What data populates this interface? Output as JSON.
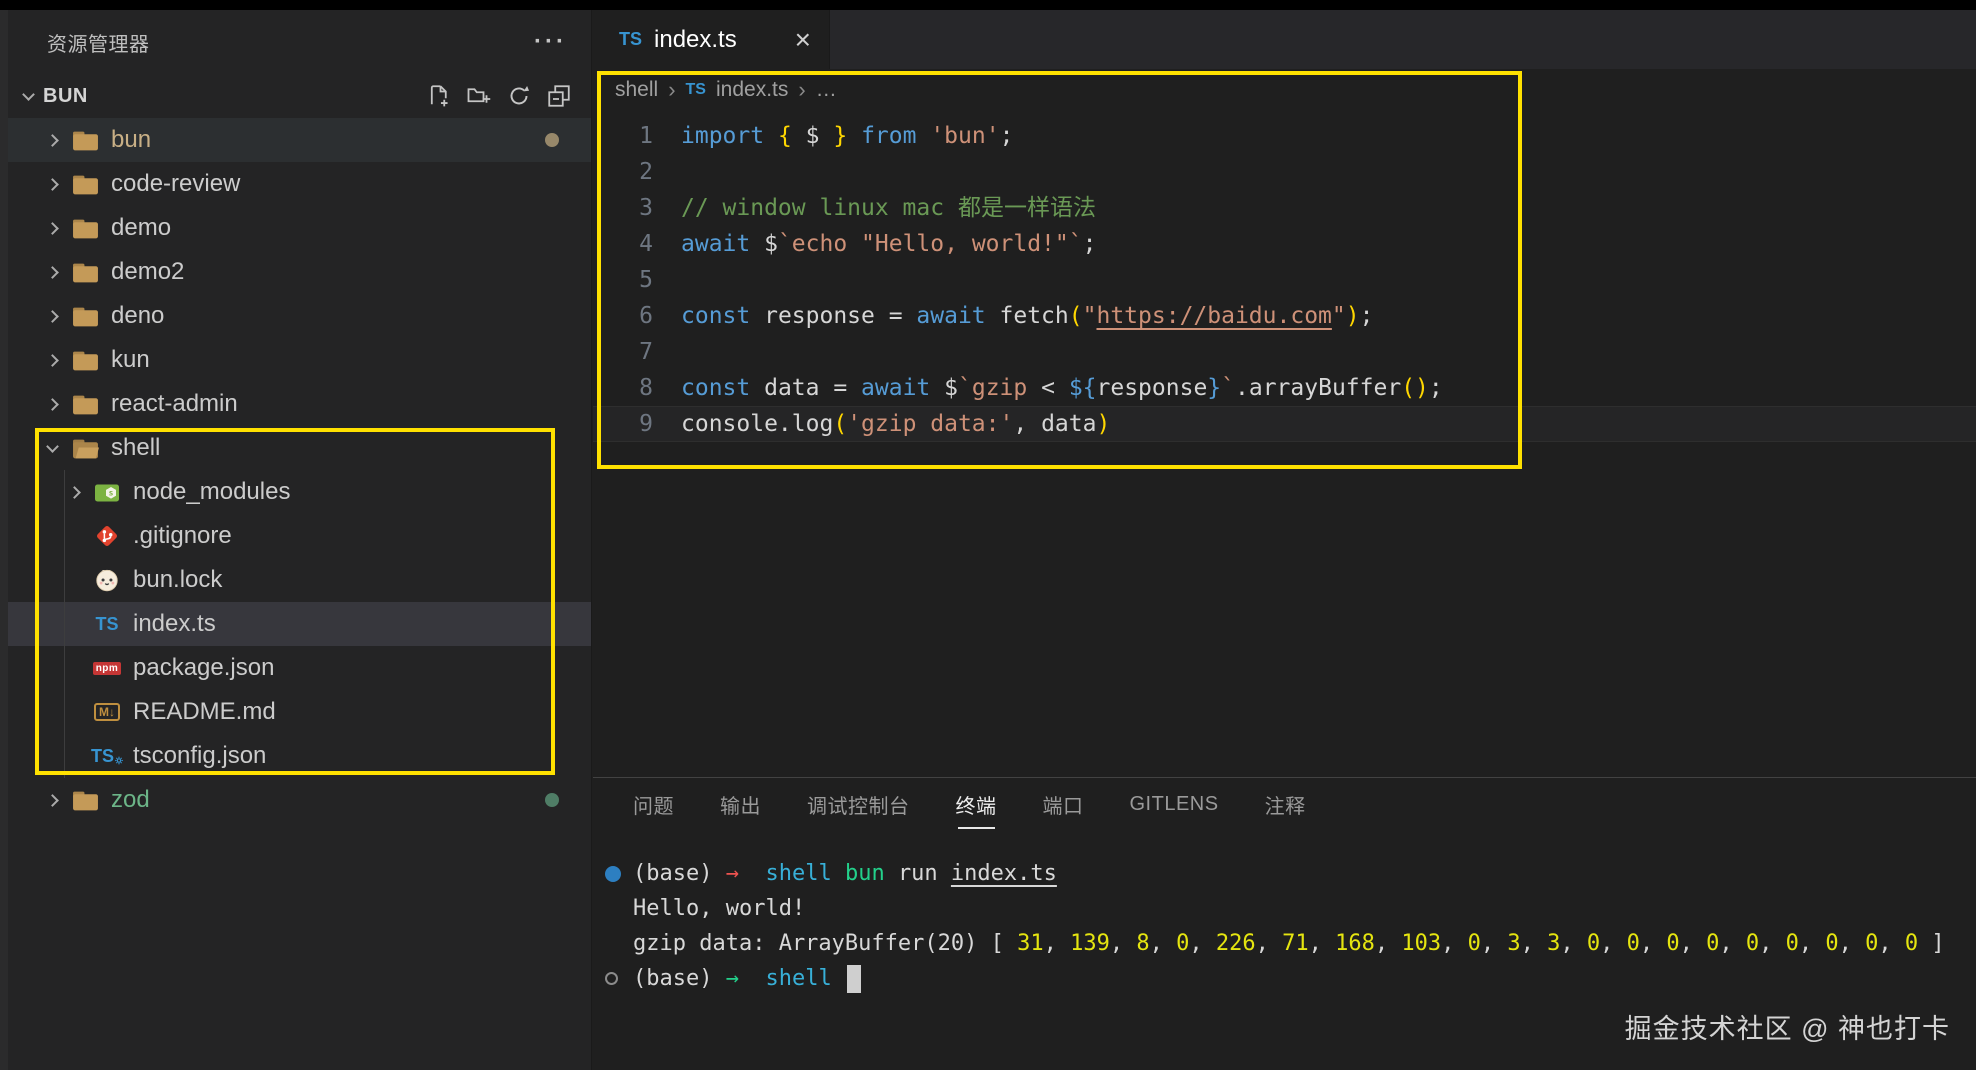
{
  "explorer": {
    "title": "资源管理器",
    "more_actions": "···",
    "section": {
      "label": "BUN"
    },
    "tree": [
      {
        "label": "bun",
        "icon": "folder",
        "chevron": "right",
        "depth": 0,
        "label_color": "#c9b086",
        "dot": "#97886a",
        "row_bg": "#2c2f31"
      },
      {
        "label": "code-review",
        "icon": "folder",
        "chevron": "right",
        "depth": 0
      },
      {
        "label": "demo",
        "icon": "folder",
        "chevron": "right",
        "depth": 0
      },
      {
        "label": "demo2",
        "icon": "folder",
        "chevron": "right",
        "depth": 0
      },
      {
        "label": "deno",
        "icon": "folder",
        "chevron": "right",
        "depth": 0
      },
      {
        "label": "kun",
        "icon": "folder",
        "chevron": "right",
        "depth": 0
      },
      {
        "label": "react-admin",
        "icon": "folder",
        "chevron": "right",
        "depth": 0
      },
      {
        "label": "shell",
        "icon": "folder-open",
        "chevron": "down",
        "depth": 0
      },
      {
        "label": "node_modules",
        "icon": "node",
        "chevron": "right",
        "depth": 1
      },
      {
        "label": ".gitignore",
        "icon": "git",
        "chevron": "none",
        "depth": 1
      },
      {
        "label": "bun.lock",
        "icon": "bun",
        "chevron": "none",
        "depth": 1
      },
      {
        "label": "index.ts",
        "icon": "ts",
        "chevron": "none",
        "depth": 1,
        "selected": true
      },
      {
        "label": "package.json",
        "icon": "npm",
        "chevron": "none",
        "depth": 1
      },
      {
        "label": "README.md",
        "icon": "md",
        "chevron": "none",
        "depth": 1
      },
      {
        "label": "tsconfig.json",
        "icon": "tsconfig",
        "chevron": "none",
        "depth": 1
      },
      {
        "label": "zod",
        "icon": "folder",
        "chevron": "right",
        "depth": 0,
        "label_color": "#6cb588",
        "dot": "#4f7d66"
      }
    ]
  },
  "editor": {
    "tab": {
      "label": "index.ts",
      "close": "×"
    },
    "breadcrumb": {
      "folder": "shell",
      "ts_badge": "TS",
      "file": "index.ts",
      "sep": "›",
      "more": "…"
    },
    "code_lines": [
      {
        "no": "1",
        "segs": [
          [
            "import ",
            "kw"
          ],
          [
            "{ ",
            "br"
          ],
          [
            "$",
            "fg"
          ],
          [
            " }",
            "br"
          ],
          [
            " ",
            "fg"
          ],
          [
            "from",
            "kw"
          ],
          [
            " ",
            "fg"
          ],
          [
            "'bun'",
            "str"
          ],
          [
            ";",
            "fg"
          ]
        ]
      },
      {
        "no": "2",
        "segs": []
      },
      {
        "no": "3",
        "segs": [
          [
            "// window linux mac 都是一样语法",
            "cm"
          ]
        ]
      },
      {
        "no": "4",
        "segs": [
          [
            "await ",
            "kw"
          ],
          [
            "$",
            "fg"
          ],
          [
            "`echo \"Hello, world!\"`",
            "str"
          ],
          [
            ";",
            "fg"
          ]
        ]
      },
      {
        "no": "5",
        "segs": []
      },
      {
        "no": "6",
        "segs": [
          [
            "const ",
            "kw"
          ],
          [
            "response ",
            "fg"
          ],
          [
            "= ",
            "fg"
          ],
          [
            "await ",
            "kw"
          ],
          [
            "fetch",
            "fg"
          ],
          [
            "(",
            "br"
          ],
          [
            "\"",
            "str"
          ],
          [
            "https://baidu.com",
            "link"
          ],
          [
            "\"",
            "str"
          ],
          [
            ")",
            "br"
          ],
          [
            ";",
            "fg"
          ]
        ]
      },
      {
        "no": "7",
        "segs": []
      },
      {
        "no": "8",
        "segs": [
          [
            "const ",
            "kw"
          ],
          [
            "data ",
            "fg"
          ],
          [
            "= ",
            "fg"
          ],
          [
            "await ",
            "kw"
          ],
          [
            "$",
            "fg"
          ],
          [
            "`",
            "str"
          ],
          [
            "gzip ",
            "str"
          ],
          [
            "< ",
            "fg"
          ],
          [
            "${",
            "kw"
          ],
          [
            "response",
            "fg"
          ],
          [
            "}",
            "kw"
          ],
          [
            "`",
            "str"
          ],
          [
            ".arrayBuffer",
            "fg"
          ],
          [
            "()",
            "br"
          ],
          [
            ";",
            "fg"
          ]
        ]
      },
      {
        "no": "9",
        "segs": [
          [
            "console.log",
            "fg"
          ],
          [
            "(",
            "br"
          ],
          [
            "'gzip data:'",
            "str"
          ],
          [
            ", ",
            "fg"
          ],
          [
            "data",
            "fg"
          ],
          [
            ")",
            "br"
          ]
        ],
        "highlight": true
      }
    ]
  },
  "panel": {
    "tabs": [
      {
        "label": "问题"
      },
      {
        "label": "输出"
      },
      {
        "label": "调试控制台"
      },
      {
        "label": "终端",
        "active": true
      },
      {
        "label": "端口"
      },
      {
        "label": "GITLENS"
      },
      {
        "label": "注释"
      }
    ],
    "terminal_lines": [
      {
        "marker": "dot",
        "segs": [
          [
            "(base) ",
            "w"
          ],
          [
            "→",
            "red"
          ],
          [
            "  ",
            "w"
          ],
          [
            "shell ",
            "cyan"
          ],
          [
            "bun ",
            "green"
          ],
          [
            "run ",
            "w"
          ],
          [
            "index.ts",
            "w u"
          ]
        ]
      },
      {
        "segs": [
          [
            "Hello, world!",
            "w"
          ]
        ]
      },
      {
        "prefix": "gzip data: ArrayBuffer(20) [ ",
        "values": [
          31,
          139,
          8,
          0,
          226,
          71,
          168,
          103,
          0,
          3,
          3,
          0,
          0,
          0,
          0,
          0,
          0,
          0,
          0,
          0
        ],
        "suffix": " ]"
      },
      {
        "marker": "circle",
        "segs": [
          [
            "(base) ",
            "w"
          ],
          [
            "→",
            "green"
          ],
          [
            "  ",
            "w"
          ],
          [
            "shell ",
            "cyan"
          ]
        ],
        "cursor": true
      }
    ]
  },
  "watermark": "掘金技术社区 @ 神也打卡"
}
